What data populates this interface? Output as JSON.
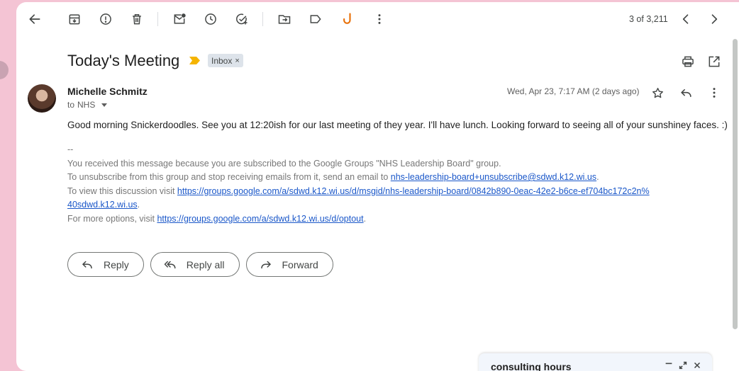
{
  "toolbar": {
    "count_text": "3 of 3,211",
    "icons": [
      "back-arrow-icon",
      "archive-icon",
      "report-spam-icon",
      "delete-icon",
      "mark-unread-icon",
      "snooze-icon",
      "add-task-icon",
      "move-to-icon",
      "label-icon",
      "extension-icon",
      "more-vert-icon",
      "chevron-left-icon",
      "chevron-right-icon"
    ]
  },
  "email": {
    "subject": "Today's Meeting",
    "label": "Inbox",
    "label_remove": "×",
    "sender": "Michelle Schmitz",
    "to_prefix": "to",
    "recipient": "NHS",
    "date": "Wed, Apr 23, 7:17 AM (2 days ago)",
    "body": "Good morning Snickerdoodles. See you at 12:20ish for our last meeting of they year. I'll have lunch. Looking forward to seeing all of your sunshiney faces. :)",
    "footer": {
      "sig_sep": "--",
      "line1": "You received this message because you are subscribed to the Google Groups \"NHS Leadership Board\" group.",
      "line2_prefix": "To unsubscribe from this group and stop receiving emails from it, send an email to ",
      "line2_link": "nhs-leadership-board+unsubscribe@sdwd.k12.wi.us",
      "line2_suffix": ".",
      "line3_prefix": "To view this discussion visit ",
      "line3_link_a": "https://groups.google.com/a/sdwd.k12.wi.us/d/msgid/nhs-leadership-board/0842b890-0eac-42e2-b6ce-ef704bc172c2n%",
      "line3_link_b": "40sdwd.k12.wi.us",
      "line3_suffix": ".",
      "line4_prefix": "For more options, visit ",
      "line4_link": "https://groups.google.com/a/sdwd.k12.wi.us/d/optout",
      "line4_suffix": "."
    }
  },
  "actions": {
    "reply": "Reply",
    "reply_all": "Reply all",
    "forward": "Forward"
  },
  "compose": {
    "title": "consulting hours"
  },
  "colors": {
    "background": "#f4c4d4",
    "link": "#1a57c9",
    "important_marker": "#f5b400",
    "extension_accent": "#e8710a"
  }
}
